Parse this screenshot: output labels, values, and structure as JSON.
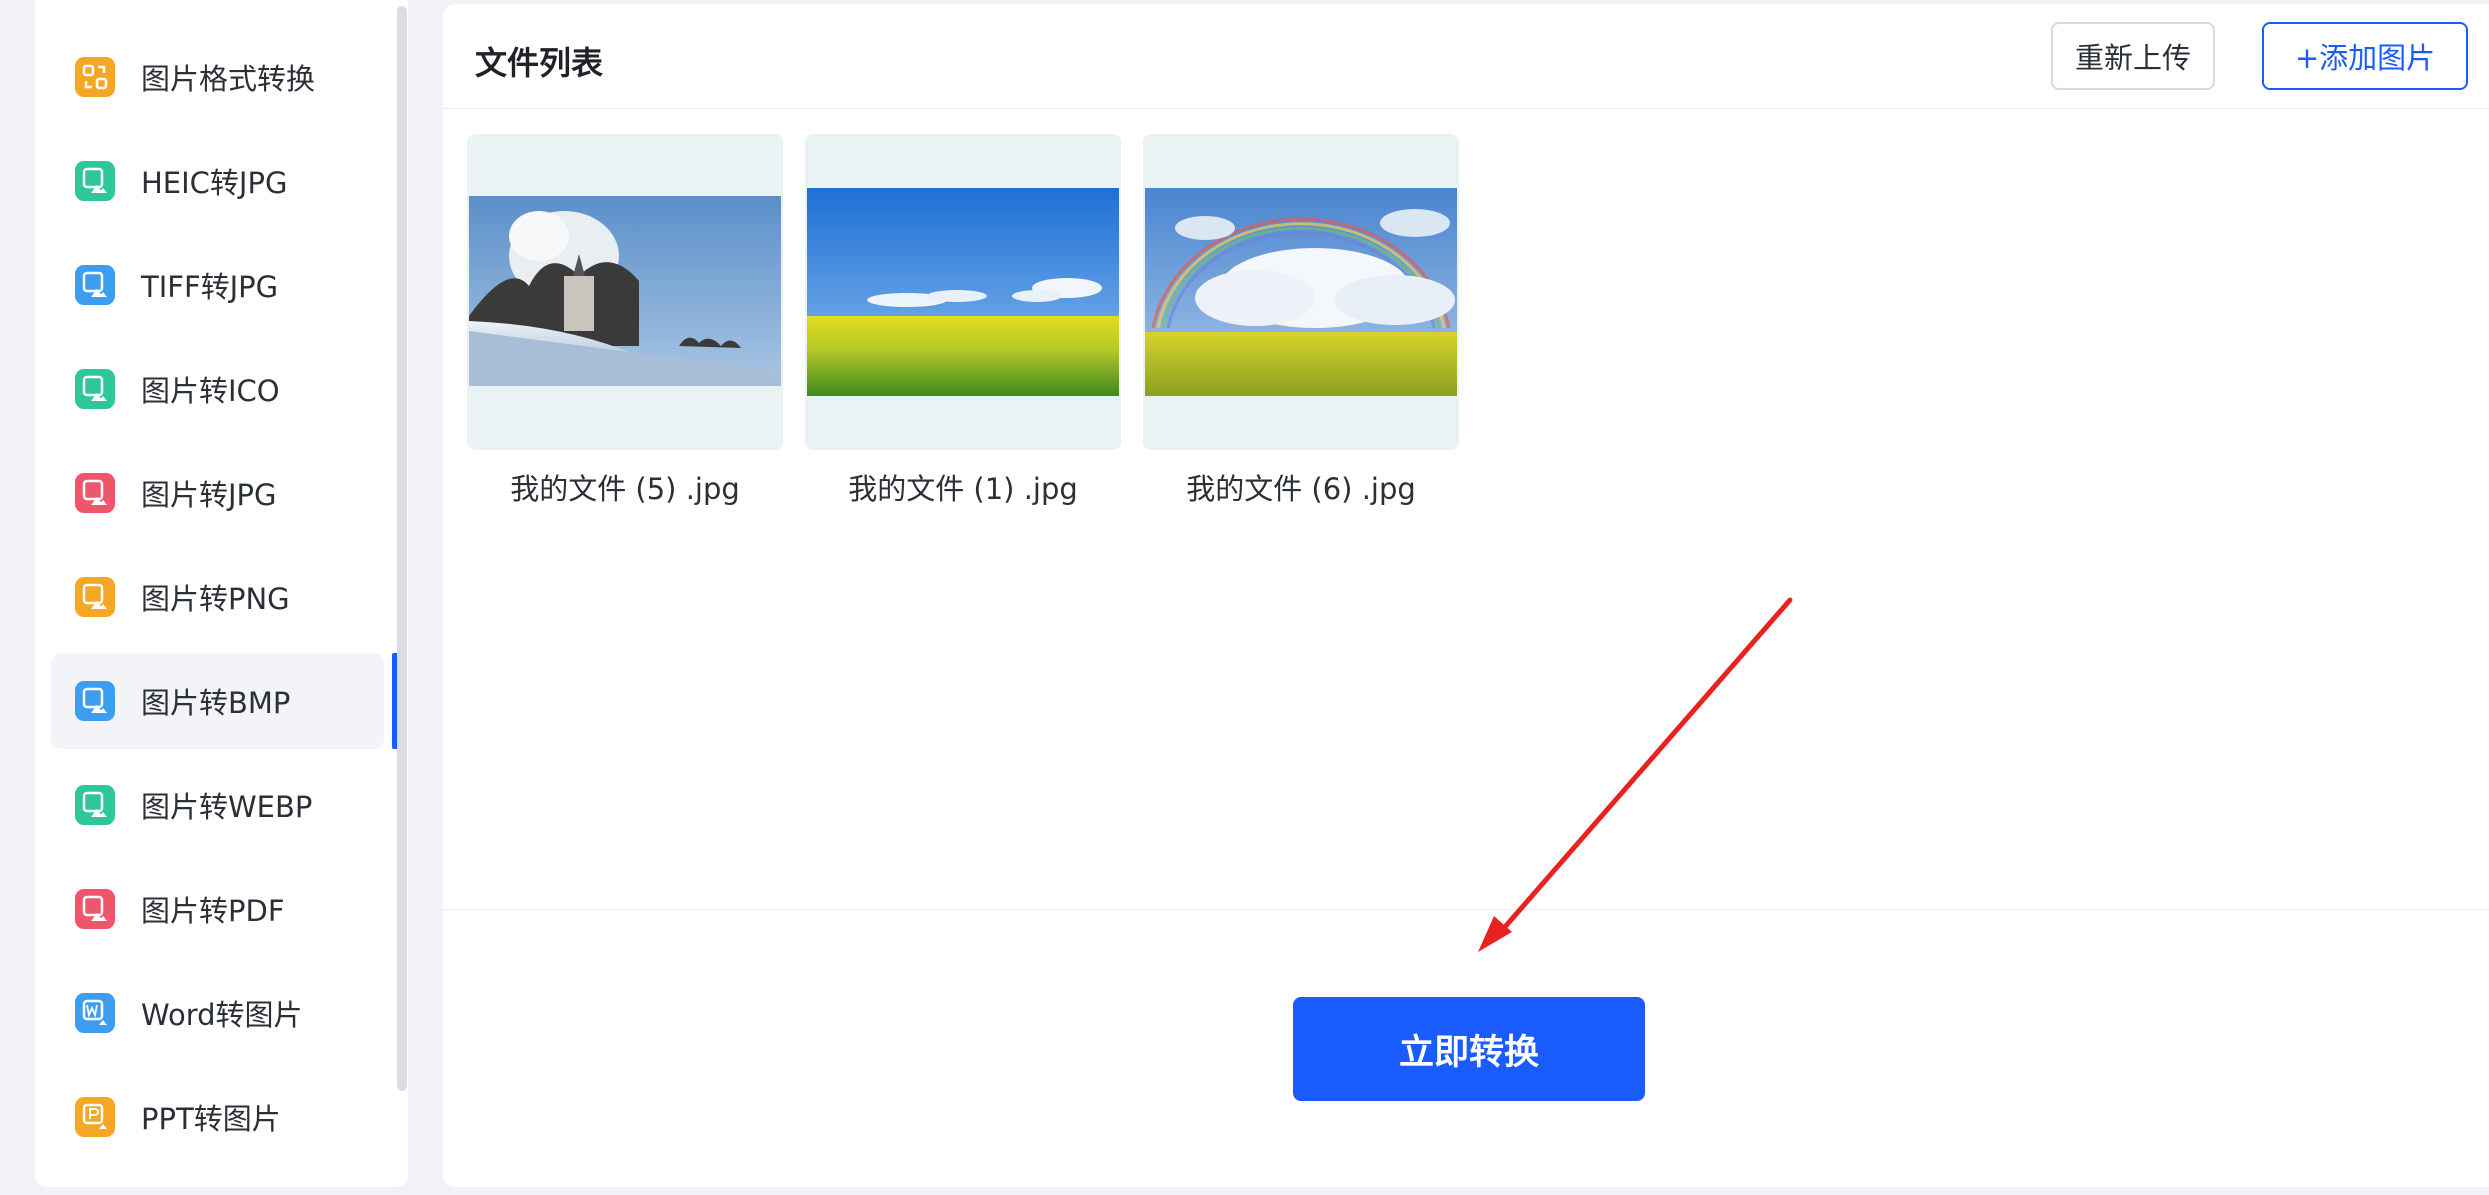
{
  "sidebar": {
    "items": [
      {
        "label": "图片格式转换",
        "icon": "format-convert-icon",
        "color": "#f5a623"
      },
      {
        "label": "HEIC转JPG",
        "icon": "heic-image-icon",
        "color": "#2ec79a"
      },
      {
        "label": "TIFF转JPG",
        "icon": "tiff-image-icon",
        "color": "#3d9df0"
      },
      {
        "label": "图片转ICO",
        "icon": "ico-image-icon",
        "color": "#2ec79a"
      },
      {
        "label": "图片转JPG",
        "icon": "jpg-image-icon",
        "color": "#f0566b"
      },
      {
        "label": "图片转PNG",
        "icon": "png-image-icon",
        "color": "#f5a623"
      },
      {
        "label": "图片转BMP",
        "icon": "bmp-image-icon",
        "color": "#3d9df0",
        "active": true
      },
      {
        "label": "图片转WEBP",
        "icon": "webp-image-icon",
        "color": "#2ec79a"
      },
      {
        "label": "图片转PDF",
        "icon": "pdf-image-icon",
        "color": "#f0566b"
      },
      {
        "label": "Word转图片",
        "icon": "word-image-icon",
        "color": "#3d9df0"
      },
      {
        "label": "PPT转图片",
        "icon": "ppt-image-icon",
        "color": "#f5a623"
      }
    ]
  },
  "main": {
    "title": "文件列表",
    "reupload_label": "重新上传",
    "add_label": "+添加图片",
    "files": [
      {
        "name": "我的文件 (5) .jpg",
        "scene": "snowy-church"
      },
      {
        "name": "我的文件 (1) .jpg",
        "scene": "rapeseed-field"
      },
      {
        "name": "我的文件 (6) .jpg",
        "scene": "rainbow-field"
      }
    ],
    "convert_label": "立即转换"
  },
  "colors": {
    "accent": "#1a5cff",
    "annotation_arrow": "#e8231f"
  }
}
